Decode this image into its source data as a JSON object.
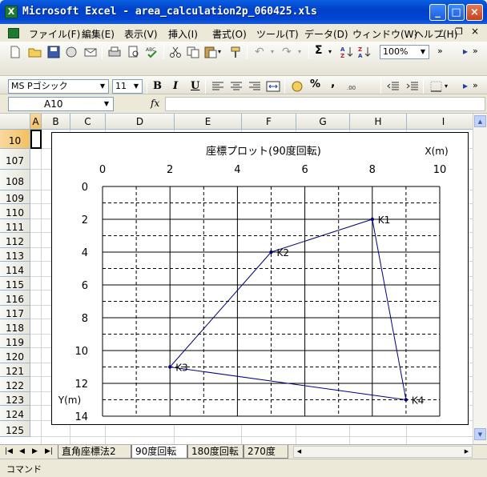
{
  "window": {
    "title": "Microsoft Excel - area_calculation2p_060425.xls",
    "app_icon_letter": "X",
    "minimize_label": "_",
    "maximize_label": "□",
    "close_label": "×"
  },
  "menu": {
    "items": [
      "ファイル(F)",
      "編集(E)",
      "表示(V)",
      "挿入(I)",
      "書式(O)",
      "ツール(T)",
      "データ(D)",
      "ウィンドウ(W)",
      "ヘルプ(H)"
    ],
    "doc_min": "_",
    "doc_restore": "❐",
    "doc_close": "×"
  },
  "toolbar": {
    "zoom": "100%",
    "sigma": "Σ",
    "font_name": "MS Pゴシック",
    "font_size": "11",
    "bold": "B",
    "italic": "I",
    "underline": "U",
    "percent": "%",
    "comma": ","
  },
  "formula_bar": {
    "name_box": "A10",
    "fx_label": "fx",
    "formula": ""
  },
  "grid": {
    "columns": [
      "A",
      "B",
      "C",
      "D",
      "E",
      "F",
      "G",
      "H",
      "I"
    ],
    "rows": [
      "10",
      "107",
      "108",
      "109",
      "110",
      "111",
      "112",
      "113",
      "114",
      "115",
      "116",
      "117",
      "118",
      "119",
      "120",
      "121",
      "122",
      "123",
      "124",
      "125"
    ],
    "active_column": "A",
    "active_row": "10"
  },
  "sheet_tabs": {
    "tabs": [
      "直角座標法2",
      "90度回転",
      "180度回転",
      "270度"
    ],
    "active": "90度回転"
  },
  "status": {
    "mode": "コマンド"
  },
  "colors": {
    "title_bar": "#0046D4",
    "grid_line": "#D4D4D4",
    "series": "#000080"
  },
  "chart_data": {
    "type": "scatter",
    "title": "座標プロット(90度回転)",
    "xlabel": "X(m)",
    "ylabel": "Y(m)",
    "xlim": [
      0,
      10
    ],
    "ylim": [
      0,
      14
    ],
    "y_inverted": true,
    "x_axis_position": "top",
    "x_ticks": [
      0,
      2,
      4,
      6,
      8,
      10
    ],
    "y_ticks": [
      0,
      2,
      4,
      6,
      8,
      10,
      12,
      14
    ],
    "grid": true,
    "closed_polygon": true,
    "points": [
      {
        "label": "K1",
        "x": 8.0,
        "y": 2.0
      },
      {
        "label": "K2",
        "x": 5.0,
        "y": 4.0
      },
      {
        "label": "K3",
        "x": 2.0,
        "y": 11.0
      },
      {
        "label": "K4",
        "x": 9.0,
        "y": 13.0
      }
    ]
  }
}
